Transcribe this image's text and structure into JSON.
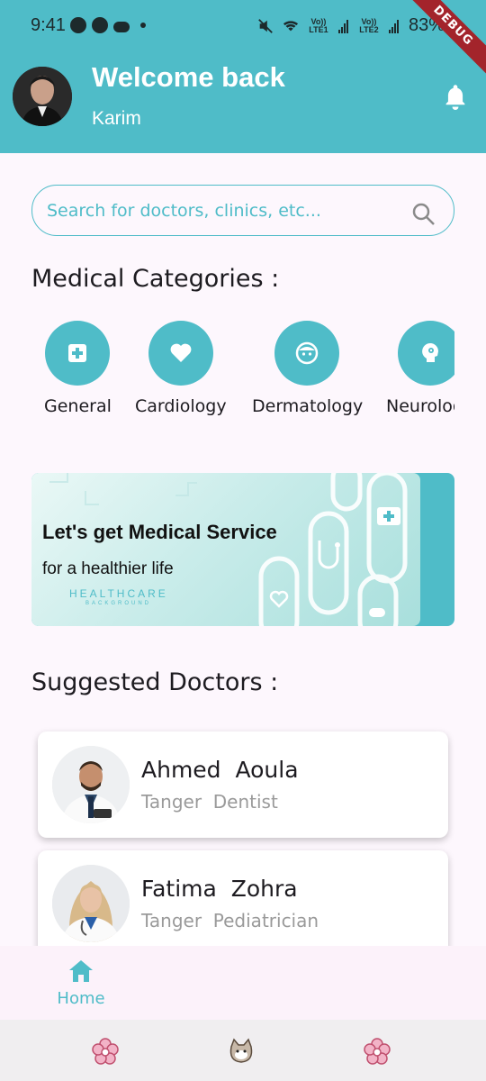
{
  "status_bar": {
    "time": "9:41",
    "battery": "83%",
    "sim1": "Vo)) LTE1",
    "sim2": "Vo)) LTE2",
    "debug_label": "DEBUG"
  },
  "header": {
    "title": "Welcome back",
    "username": "Karim"
  },
  "search": {
    "placeholder": "Search for doctors, clinics, etc..."
  },
  "categories_section": {
    "title": "Medical Categories :",
    "items": [
      {
        "label": "General",
        "icon": "plus-square-icon"
      },
      {
        "label": "Cardiology",
        "icon": "heart-icon"
      },
      {
        "label": "Dermatology",
        "icon": "face-icon"
      },
      {
        "label": "Neurology",
        "icon": "head-gear-icon"
      }
    ]
  },
  "banner": {
    "line1": "Let's get Medical Service",
    "line2": "for a healthier life",
    "brand": "HEALTHCARE",
    "brand_sub": "BACKGROUND"
  },
  "doctors_section": {
    "title": "Suggested Doctors :",
    "items": [
      {
        "first_name": "Ahmed",
        "last_name": "Aoula",
        "city": "Tanger",
        "specialty": "Dentist"
      },
      {
        "first_name": "Fatima",
        "last_name": "Zohra",
        "city": "Tanger",
        "specialty": "Pediatrician"
      }
    ]
  },
  "bottom_nav": {
    "home_label": "Home"
  },
  "colors": {
    "primary": "#4fbcc8",
    "background": "#fdf7fd",
    "debug_ribbon": "#a3242b"
  }
}
